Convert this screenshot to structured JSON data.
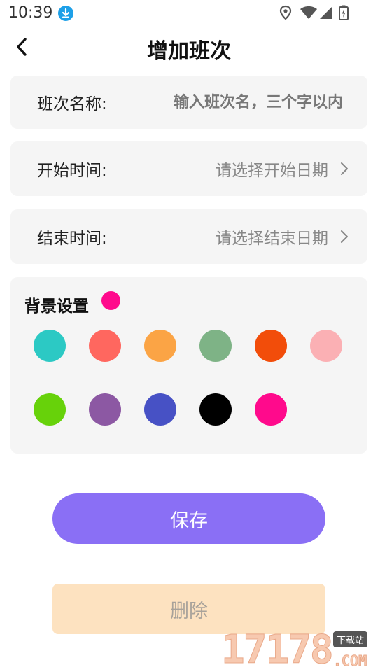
{
  "status_bar": {
    "time": "10:39",
    "icons": [
      "download-icon",
      "location-icon",
      "wifi-icon",
      "signal-icon",
      "battery-icon"
    ]
  },
  "header": {
    "title": "增加班次",
    "back_icon": "chevron-left-icon"
  },
  "form": {
    "name": {
      "label": "班次名称:",
      "placeholder": "输入班次名，三个字以内",
      "value": ""
    },
    "start": {
      "label": "开始时间:",
      "value": "请选择开始日期"
    },
    "end": {
      "label": "结束时间:",
      "value": "请选择结束日期"
    }
  },
  "background": {
    "title": "背景设置",
    "selected_color": "#ff0a8c",
    "swatches": [
      "#2cc9c4",
      "#ff675f",
      "#fba445",
      "#7eb386",
      "#f24d0a",
      "#fbb0b4",
      "#67d20a",
      "#8c58a3",
      "#4751c5",
      "#000000",
      "#ff0a8c"
    ]
  },
  "actions": {
    "save_label": "保存",
    "delete_label": "删除"
  },
  "watermark": {
    "digits": "17178",
    "tag": "下载站",
    "suffix": ".COM"
  },
  "colors": {
    "accent": "#8a6ff5",
    "delete_bg": "#fde2c0",
    "card_bg": "#f5f5f5"
  }
}
